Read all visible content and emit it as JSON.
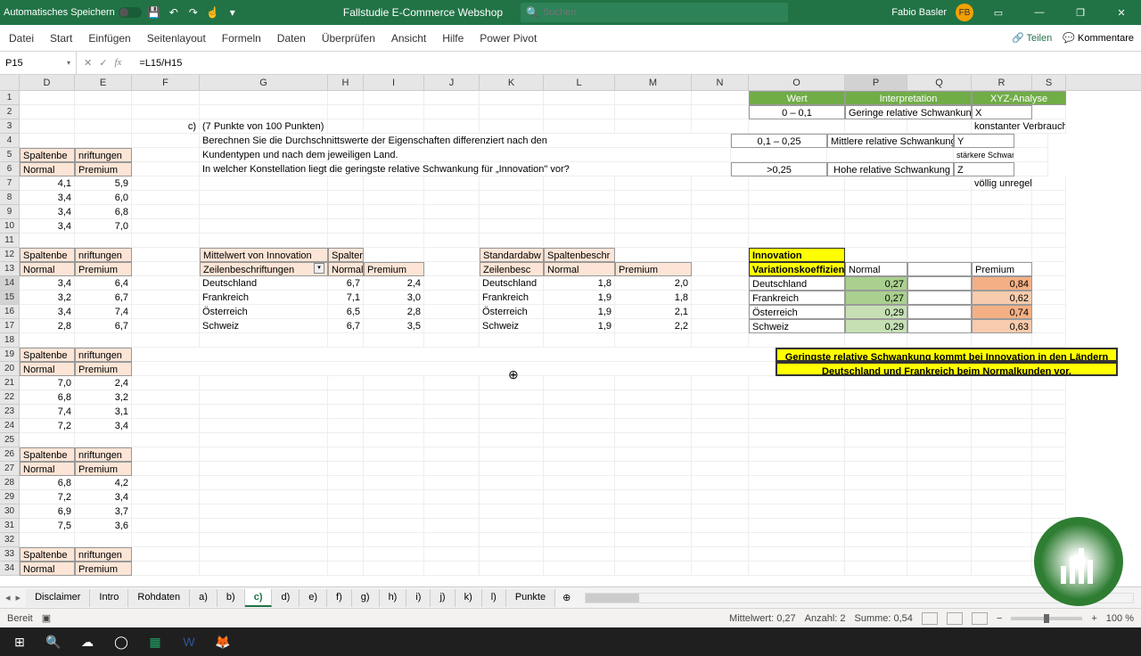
{
  "titlebar": {
    "autosave": "Automatisches Speichern",
    "doc": "Fallstudie E-Commerce Webshop",
    "search_ph": "Suchen",
    "user": "Fabio Basler",
    "initials": "FB"
  },
  "ribbon": {
    "tabs": [
      "Datei",
      "Start",
      "Einfügen",
      "Seitenlayout",
      "Formeln",
      "Daten",
      "Überprüfen",
      "Ansicht",
      "Hilfe",
      "Power Pivot"
    ],
    "share": "Teilen",
    "comments": "Kommentare"
  },
  "formula": {
    "cell": "P15",
    "value": "=L15/H15"
  },
  "cols": [
    "D",
    "E",
    "F",
    "G",
    "H",
    "I",
    "J",
    "K",
    "L",
    "M",
    "N",
    "O",
    "P",
    "Q",
    "R",
    "S"
  ],
  "task": {
    "label": "c)",
    "pts": "(7 Punkte von 100 Punkten)",
    "l1": "Berechnen Sie die Durchschnittswerte der Eigenschaften differenziert nach den",
    "l2": "Kundentypen und nach dem jeweiligen Land.",
    "l3": "In welcher Konstellation liegt die geringste relative Schwankung für „Innovation\" vor?"
  },
  "legend": {
    "h1": "Wert",
    "h2": "Interpretation",
    "h3": "XYZ-Analyse",
    "r1w": "0 – 0,1",
    "r1i": "Geringe relative Schwankung",
    "r1x": "X",
    "r1d": "konstanter Verbrauch, Schwankungen sind eher selten",
    "r2w": "0,1 – 0,25",
    "r2i": "Mittlere relative Schwankung",
    "r2x": "Y",
    "r2d": "stärkere Schwankungen im Verbrauch, meist aus trendmäßigen oder saisonalen Gründen",
    "r3w": ">0,25",
    "r3i": "Hohe relative Schwankung",
    "r3x": "Z",
    "r3d": "völlig unregelmäßiger Verbrauch"
  },
  "piv": {
    "colhdr": "Spaltenbe",
    "colhdr2": "nriftungen",
    "normal": "Normal",
    "premium": "Premium",
    "s1": [
      [
        "4,1",
        "5,9"
      ],
      [
        "3,4",
        "6,0"
      ],
      [
        "3,4",
        "6,8"
      ],
      [
        "3,4",
        "7,0"
      ]
    ],
    "s2": [
      [
        "3,4",
        "6,4"
      ],
      [
        "3,2",
        "6,7"
      ],
      [
        "3,4",
        "7,4"
      ],
      [
        "2,8",
        "6,7"
      ]
    ],
    "s3": [
      [
        "7,0",
        "2,4"
      ],
      [
        "6,8",
        "3,2"
      ],
      [
        "7,4",
        "3,1"
      ],
      [
        "7,2",
        "3,4"
      ]
    ],
    "s4": [
      [
        "6,8",
        "4,2"
      ],
      [
        "7,2",
        "3,4"
      ],
      [
        "6,9",
        "3,7"
      ],
      [
        "7,5",
        "3,6"
      ]
    ]
  },
  "mean": {
    "title": "Mittelwert von Innovation",
    "spalt": "Spalter",
    "rowlbl": "Zeilenbeschriftungen",
    "rows": [
      "Deutschland",
      "Frankreich",
      "Österreich",
      "Schweiz"
    ],
    "n": [
      "6,7",
      "7,1",
      "6,5",
      "6,7"
    ],
    "p": [
      "2,4",
      "3,0",
      "2,8",
      "3,5"
    ]
  },
  "std": {
    "title": "Standardabw",
    "spalt": "Spaltenbeschr",
    "rowlbl": "Zeilenbesc",
    "n": [
      "1,8",
      "1,9",
      "1,9",
      "1,9"
    ],
    "p": [
      "2,0",
      "1,8",
      "2,1",
      "2,2"
    ]
  },
  "coef": {
    "title": "Innovation",
    "sub": "Variationskoeffizient",
    "rows": [
      "Deutschland",
      "Frankreich",
      "Österreich",
      "Schweiz"
    ],
    "n": [
      "0,27",
      "0,27",
      "0,29",
      "0,29"
    ],
    "p": [
      "0,84",
      "0,62",
      "0,74",
      "0,63"
    ]
  },
  "msg": {
    "l1": "Geringste relative Schwankung kommt bei Innovation in den Ländern",
    "l2": "Deutschland und Frankreich beim Normalkunden vor."
  },
  "sheets": [
    "Disclaimer",
    "Intro",
    "Rohdaten",
    "a)",
    "b)",
    "c)",
    "d)",
    "e)",
    "f)",
    "g)",
    "h)",
    "i)",
    "j)",
    "k)",
    "l)",
    "Punkte"
  ],
  "status": {
    "ready": "Bereit",
    "avg": "Mittelwert: 0,27",
    "cnt": "Anzahl: 2",
    "sum": "Summe: 0,54",
    "zoom": "100 %"
  }
}
